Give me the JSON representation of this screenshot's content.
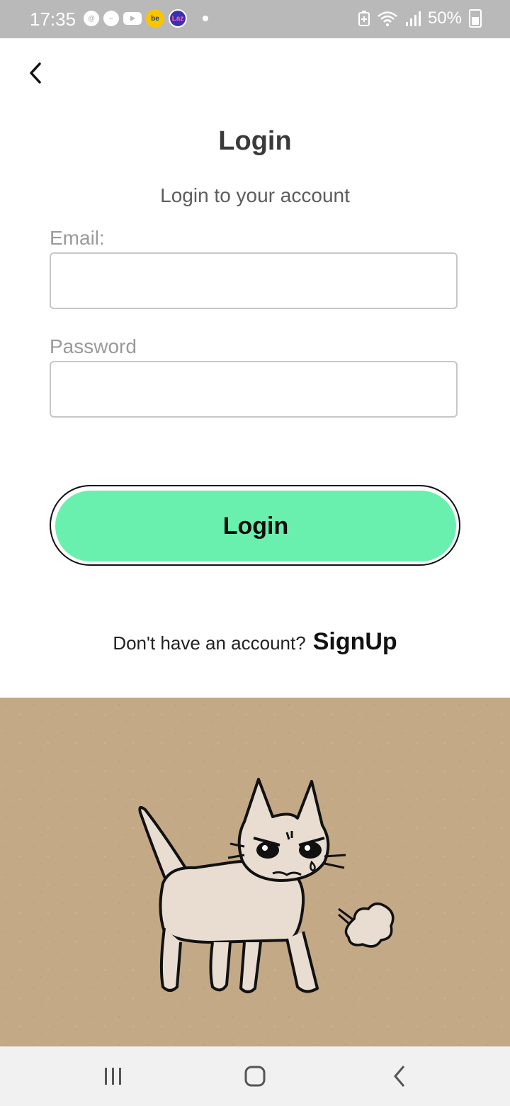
{
  "status_bar": {
    "time": "17:35",
    "battery": "50%",
    "icons": [
      "threads-icon",
      "messenger-icon",
      "youtube-icon",
      "be-app-icon",
      "lazada-app-icon",
      "notification-dot-icon",
      "battery-saver-icon",
      "wifi-icon",
      "signal-icon",
      "battery-icon"
    ],
    "app_labels": {
      "be": "be",
      "laz": "Laz"
    }
  },
  "header": {
    "back_icon": "back-arrow-icon",
    "title": "Login",
    "subtitle": "Login to your account"
  },
  "form": {
    "email_label": "Email:",
    "email_value": "",
    "password_label": "Password",
    "password_value": ""
  },
  "actions": {
    "login_label": "Login",
    "signup_prompt": "Don't have an account?",
    "signup_label": "SignUp"
  },
  "colors": {
    "button_fill": "#69f0ae",
    "illustration_bg": "#c4a987",
    "status_bar_bg": "#b9b9b9"
  },
  "illustration": {
    "subject": "angry-cat-illustration"
  },
  "nav_bar": {
    "items": [
      "recent-apps-icon",
      "home-icon",
      "back-icon"
    ]
  }
}
